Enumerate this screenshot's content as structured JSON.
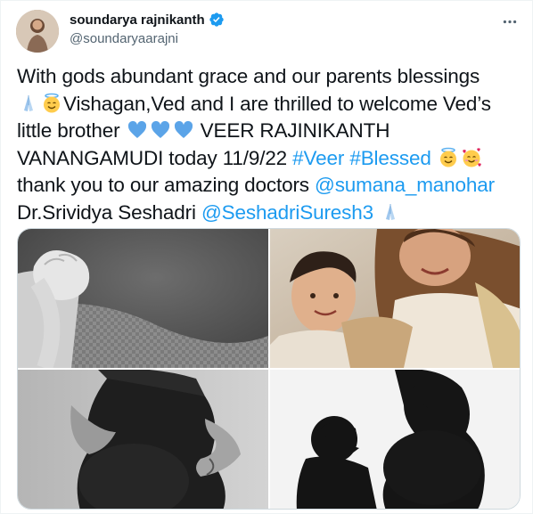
{
  "tweet": {
    "display_name": "soundarya rajnikanth",
    "handle": "@soundaryaarajni",
    "verified_icon": "verified-badge-icon",
    "more_icon": "more-options-icon",
    "text": {
      "l1": "With gods abundant grace and our parents blessings",
      "l2": "Vishagan,Ved and I are thrilled to welcome Ved’s",
      "l3a": "little brother ",
      "l3b": " VEER RAJINIKANTH",
      "l4a": "VANANGAMUDI today 11/9/22 ",
      "l4_tag1": "#Veer",
      "l4_tag2": "#Blessed",
      "l5a": "thank you to our amazing doctors ",
      "l5_mention": "@sumana_manohar",
      "l6a": "Dr.Srividya Seshadri ",
      "l6_mention": "@SeshadriSuresh3"
    },
    "emojis": [
      "folded-hands-icon",
      "smiling-face-with-halo-icon",
      "blue-heart-icon",
      "smiling-face-with-hearts-icon"
    ],
    "photos": [
      "newborn-hand-photo",
      "mother-and-son-photo",
      "pregnancy-portrait-photo",
      "pregnancy-silhouette-photo"
    ]
  },
  "colors": {
    "text": "#0f1419",
    "secondary": "#536471",
    "link": "#1d9bf0",
    "verified": "#1d9bf0",
    "heart": "#5ba4e8"
  }
}
